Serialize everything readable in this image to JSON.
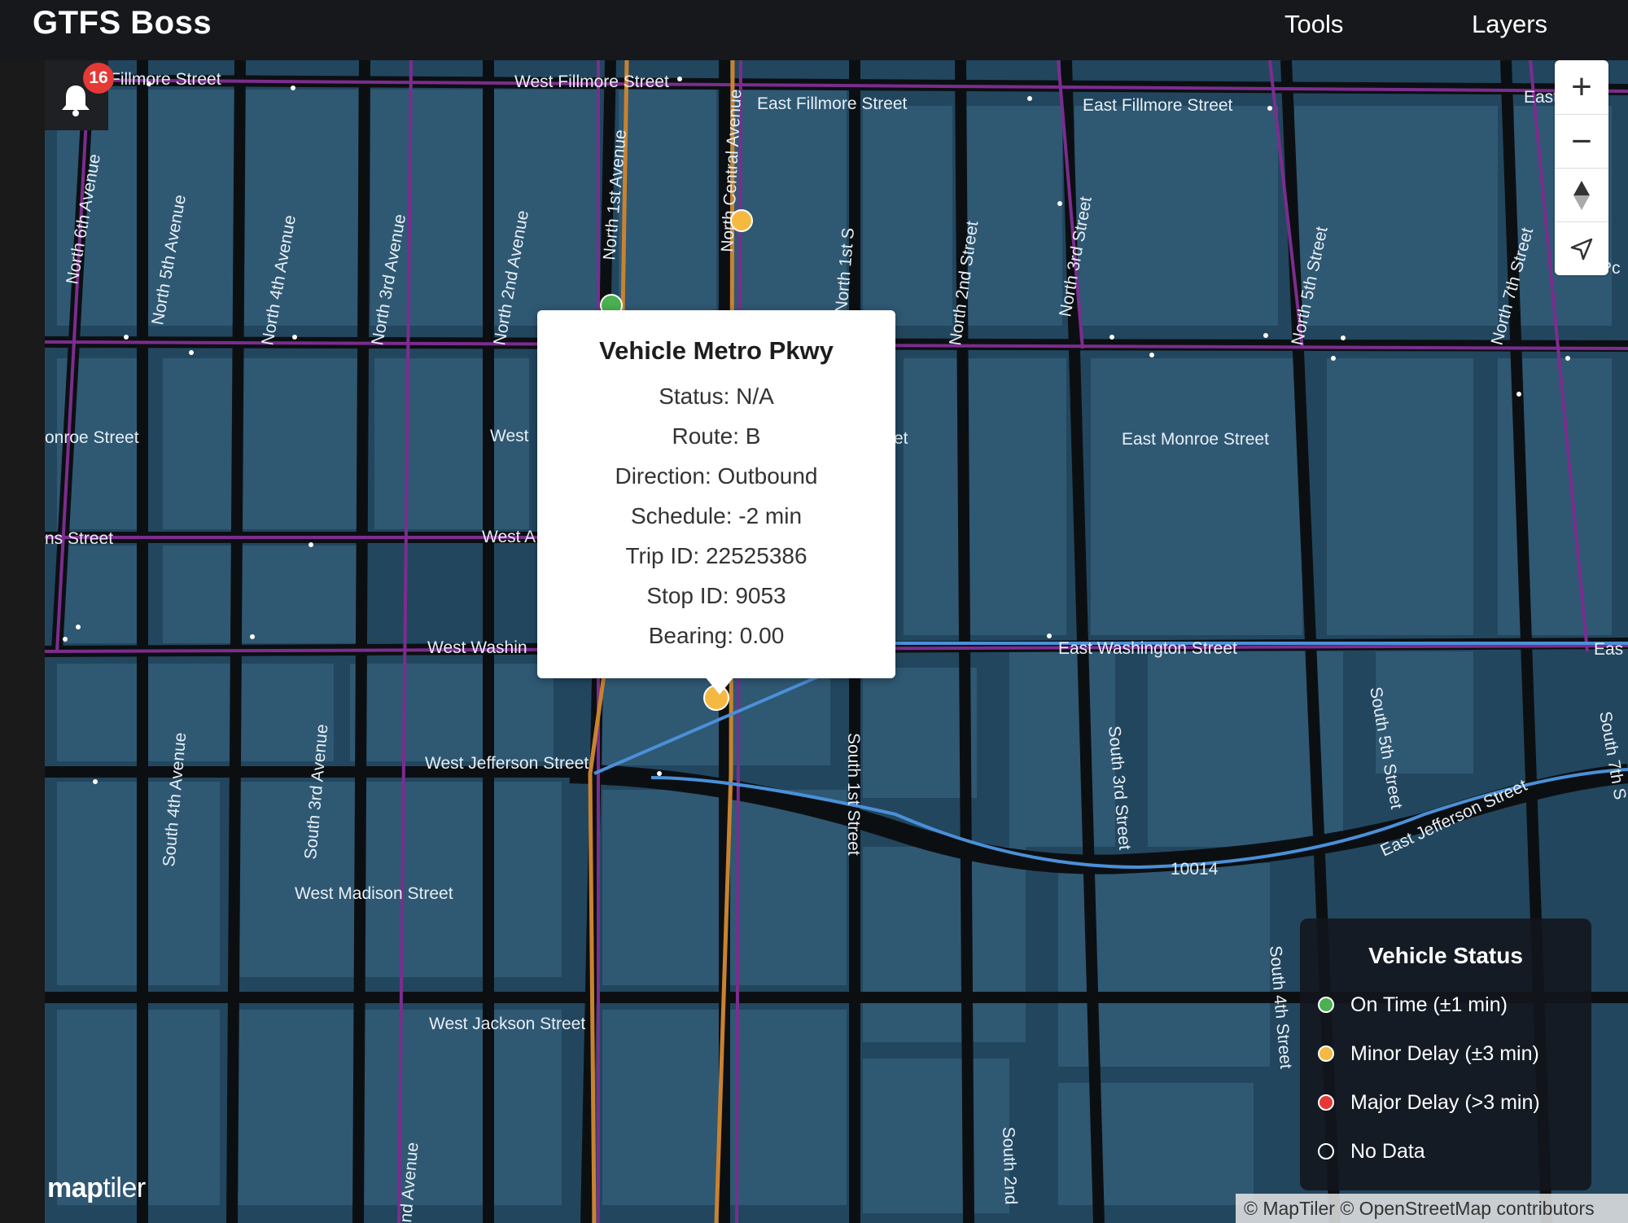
{
  "header": {
    "brand": "GTFS Boss",
    "nav": {
      "tools": "Tools",
      "layers": "Layers"
    }
  },
  "notifications": {
    "count": "16",
    "icon": "bell-icon"
  },
  "map_controls": {
    "zoom_in": "+",
    "zoom_out": "−",
    "compass_icon": "compass-icon",
    "locate_icon": "locate-arrow-icon"
  },
  "popup": {
    "title": "Vehicle Metro Pkwy",
    "lines": [
      "Status: N/A",
      "Route: B",
      "Direction: Outbound",
      "Schedule: -2 min",
      "Trip ID: 22525386",
      "Stop ID: 9053",
      "Bearing: 0.00"
    ]
  },
  "legend": {
    "title": "Vehicle Status",
    "items": [
      {
        "label": "On Time (±1 min)",
        "color": "#4caf50"
      },
      {
        "label": "Minor Delay (±3 min)",
        "color": "#f5b942"
      },
      {
        "label": "Major Delay (>3 min)",
        "color": "#e53935"
      },
      {
        "label": "No Data",
        "color": "transparent"
      }
    ]
  },
  "attribution": "© MapTiler © OpenStreetMap contributors",
  "logo": {
    "bold": "map",
    "light": "tiler"
  },
  "street_labels": {
    "fillmore_w1": "Fillmore Street",
    "fillmore_w2": "West Fillmore Street",
    "fillmore_e1": "East Fillmore Street",
    "fillmore_e2": "East Fillmore Street",
    "fillmore_e3": "East",
    "monroe_w": "onroe Street",
    "monroe_w2": "West",
    "monroe_e": "East Monroe Street",
    "adams_w": "ns Street",
    "adams_w2": "West A",
    "washington_w": "West Washin",
    "washington_e": "East Washington Street",
    "washington_e2": "Eas",
    "jefferson_w": "West Jefferson Street",
    "jefferson_e": "East Jefferson Street",
    "madison_w": "West Madison Street",
    "jackson_w": "West Jackson Street",
    "n6": "North 6th Avenue",
    "n5": "North 5th Avenue",
    "n4": "North 4th Avenue",
    "n3": "North 3rd Avenue",
    "n2": "North 2nd Avenue",
    "n1": "North 1st Avenue",
    "ncentral": "North Central Avenue",
    "n1st": "North 1st S",
    "n2nd": "North 2nd Street",
    "n3rd": "North 3rd Street",
    "n5th": "North 5th Street",
    "n7th": "North 7th Street",
    "s4": "South 4th Avenue",
    "s3": "South 3rd Avenue",
    "s1st": "South 1st Street",
    "s3rd": "South 3rd Street",
    "s5th": "South 5th Street",
    "s4th": "South 4th Street",
    "s2nd": "South 2nd",
    "s7th": "South 7th S",
    "ave_bottom": "nd Avenue",
    "route_num": "10014",
    "et": "et",
    "pc": "Pc"
  },
  "vehicles": [
    {
      "status": "minor-delay",
      "color": "#f5b942"
    },
    {
      "status": "on-time",
      "color": "#4caf50"
    },
    {
      "status": "minor-delay",
      "color": "#f5b942"
    }
  ],
  "colors": {
    "map_bg": "#22465e",
    "block": "#2f5873",
    "road": "#0c0f12",
    "route_purple": "#7b2d8e",
    "route_orange": "#c9822f",
    "route_blue": "#4a90d9"
  }
}
